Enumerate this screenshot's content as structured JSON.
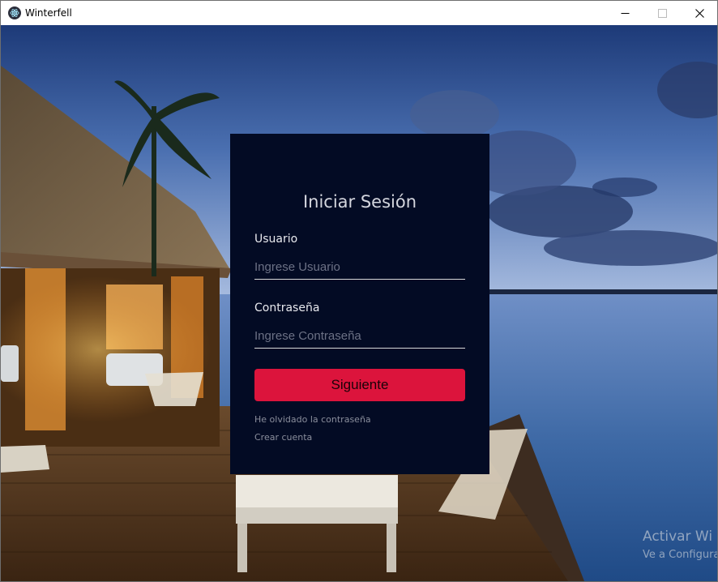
{
  "window": {
    "title": "Winterfell",
    "app_icon": "electron-atom-icon",
    "controls": [
      "minimize-icon",
      "maximize-icon",
      "close-icon"
    ]
  },
  "login": {
    "title": "Iniciar Sesión",
    "username": {
      "label": "Usuario",
      "placeholder": "Ingrese Usuario",
      "value": ""
    },
    "password": {
      "label": "Contraseña",
      "placeholder": "Ingrese Contraseña",
      "value": ""
    },
    "submit_label": "Siguiente",
    "forgot_password_link": "He olvidado la contraseña",
    "create_account_link": "Crear cuenta"
  },
  "watermark": {
    "line1": "Activar Wi",
    "line2": "Ve a Configura"
  },
  "colors": {
    "panel_bg": "#030b24",
    "accent": "#dc143c"
  }
}
